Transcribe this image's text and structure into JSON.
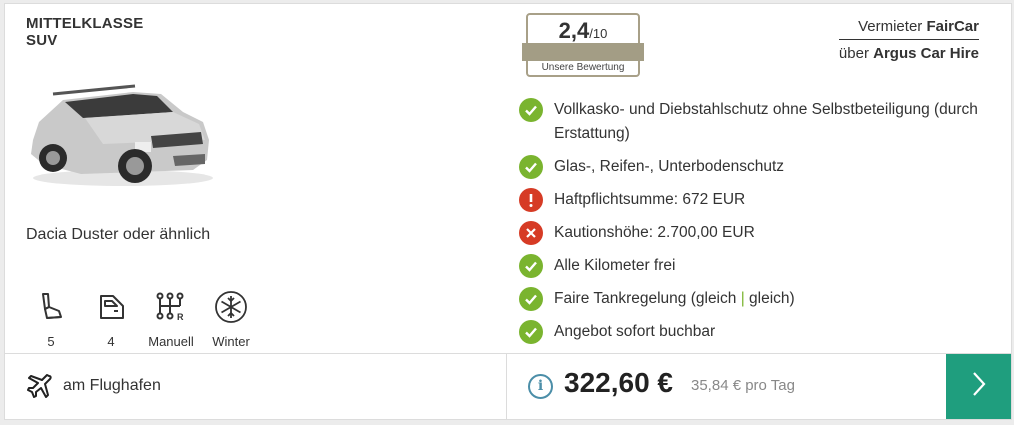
{
  "offer": {
    "category_line1": "MITTELKLASSE",
    "category_line2": "SUV",
    "car_name": "Dacia Duster oder ähnlich",
    "features": [
      {
        "icon": "seat-icon",
        "label": "5"
      },
      {
        "icon": "door-icon",
        "label": "4"
      },
      {
        "icon": "gearshift-icon",
        "label": "Manuell"
      },
      {
        "icon": "snowflake-icon",
        "label": "Winter"
      }
    ],
    "rating": {
      "score": "2,4",
      "scale": "/10",
      "caption": "Unsere Bewertung"
    },
    "vendor": {
      "prefix": "Vermieter",
      "name": "FairCar",
      "via_prefix": "über",
      "via_name": "Argus Car Hire"
    },
    "conditions": [
      {
        "status": "ok",
        "text": "Vollkasko- und Diebstahlschutz ohne Selbstbeteiligung (durch Erstattung)"
      },
      {
        "status": "ok",
        "text": "Glas-, Reifen-, Unterbodenschutz"
      },
      {
        "status": "warn",
        "text": "Haftpflichtsumme: 672 EUR"
      },
      {
        "status": "no",
        "text": "Kautionshöhe: 2.700,00 EUR"
      },
      {
        "status": "ok",
        "text": "Alle Kilometer frei"
      },
      {
        "status": "ok",
        "text_a": "Faire Tankregelung (gleich ",
        "sep": "|",
        "text_b": " gleich)"
      },
      {
        "status": "ok",
        "text": "Angebot sofort buchbar"
      }
    ],
    "pickup": "am Flughafen",
    "price": "322,60 €",
    "price_per_day": "35,84 € pro Tag",
    "colors": {
      "ok": "#7ab42f",
      "error": "#d63b25",
      "cta": "#1f9e7e",
      "info": "#4b8ea8"
    }
  }
}
